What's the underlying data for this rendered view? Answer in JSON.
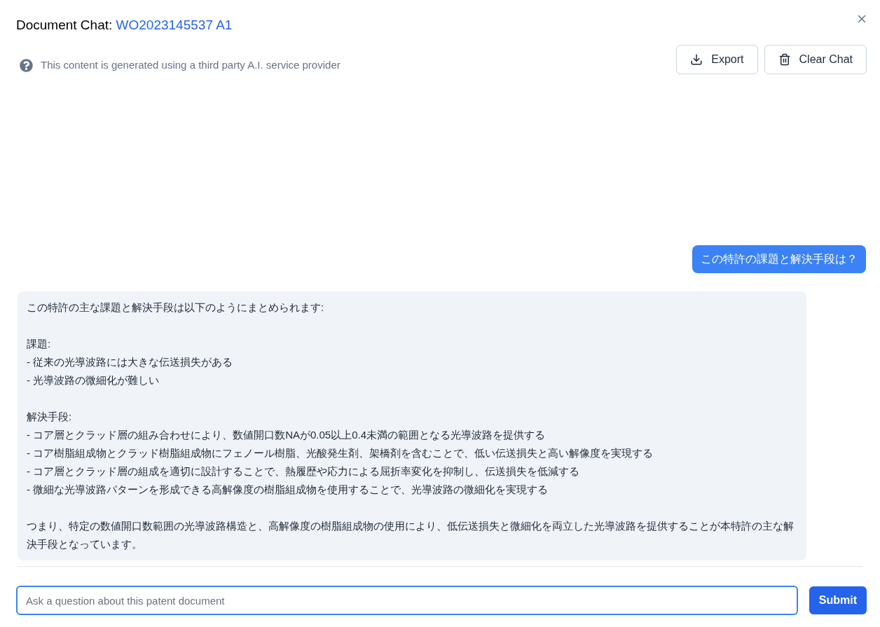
{
  "header": {
    "title": "Document Chat:",
    "document_id": "WO2023145537 A1"
  },
  "disclaimer": "This content is generated using a third party A.I. service provider",
  "actions": [
    "Export",
    "Clear Chat"
  ],
  "messages": [
    {
      "kind": "user",
      "paragraphs": [
        [
          "この特許の課題と解決手段は？"
        ]
      ]
    },
    {
      "kind": "assistant",
      "paragraphs": [
        [
          "この特許の主な課題と解決手段は以下のようにまとめられます:"
        ],
        [
          "課題:",
          "- 従来の光導波路には大きな伝送損失がある",
          "- 光導波路の微細化が難しい"
        ],
        [
          "解決手段:",
          "- コア層とクラッド層の組み合わせにより、数値開口数NAが0.05以上0.4未満の範囲となる光導波路を提供する",
          "- コア樹脂組成物とクラッド樹脂組成物にフェノール樹脂、光酸発生剤、架橋剤を含むことで、低い伝送損失と高い解像度を実現する",
          "- コア層とクラッド層の組成を適切に設計することで、熱履歴や応力による屈折率変化を抑制し、伝送損失を低減する",
          "- 微細な光導波路パターンを形成できる高解像度の樹脂組成物を使用することで、光導波路の微細化を実現する"
        ],
        [
          "つまり、特定の数値開口数範囲の光導波路構造と、高解像度の樹脂組成物の使用により、低伝送損失と微細化を両立した光導波路を提供することが本特許の主な解決手段となっています。"
        ]
      ]
    }
  ],
  "input": {
    "placeholder": "Ask a question about this patent document"
  },
  "submit": "Submit"
}
